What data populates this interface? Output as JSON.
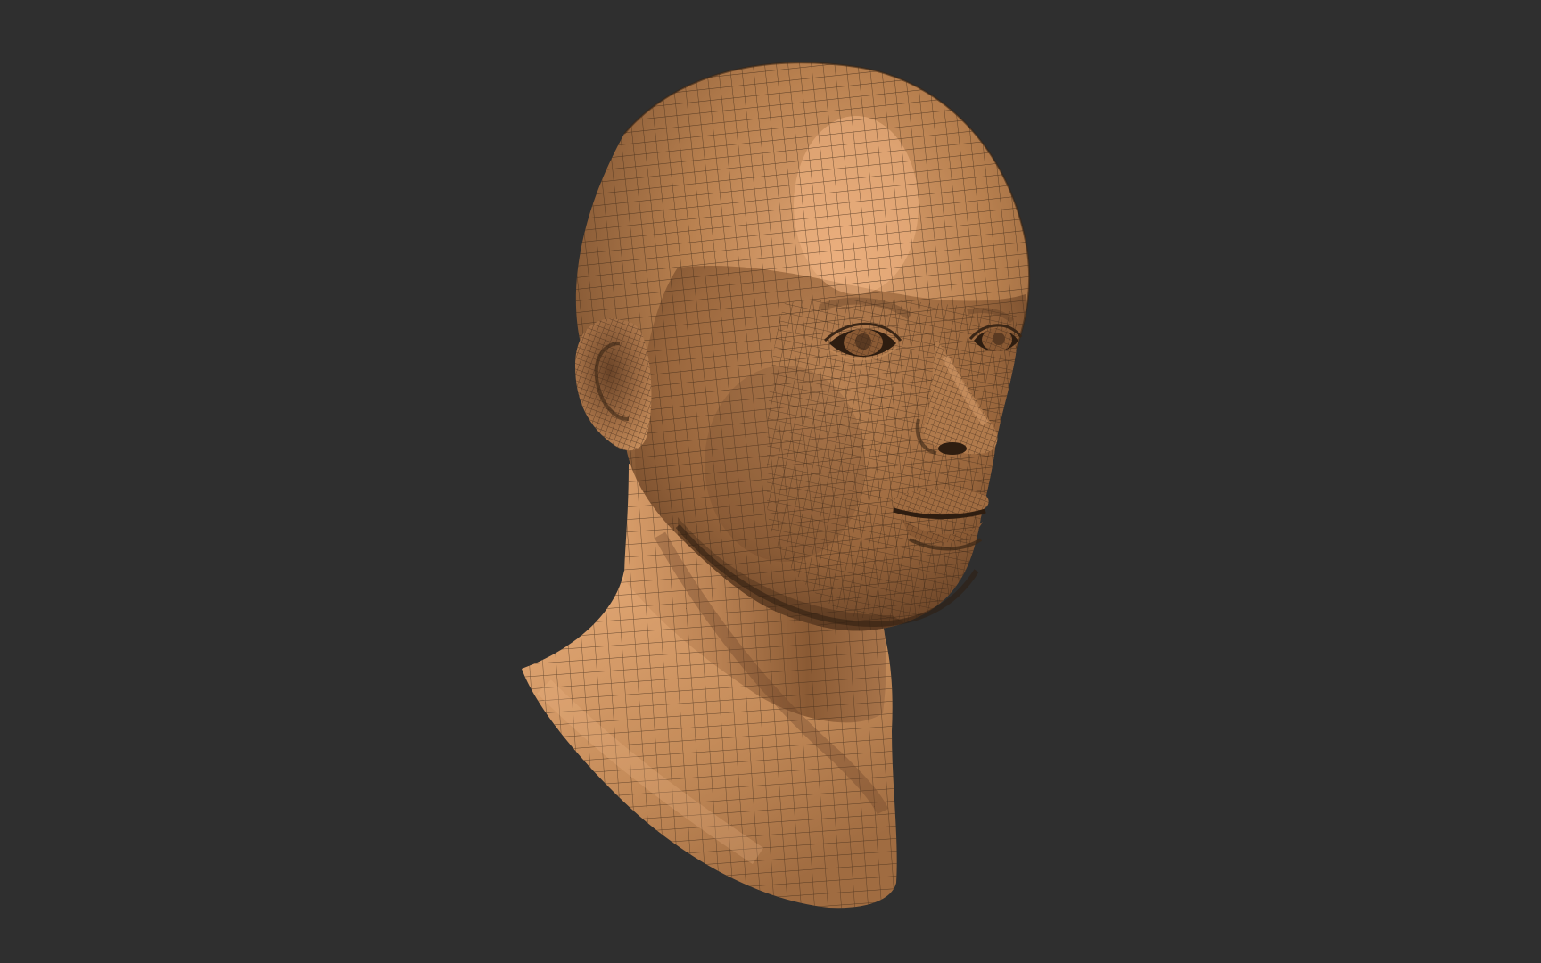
{
  "viewport": {
    "background_color": "#2f2f2f",
    "model": {
      "name": "head-bust-wireframe",
      "base_color": "#b07a4c",
      "highlight_color": "#e0a574",
      "shadow_color": "#5a3a22",
      "wire_color": "#3a2616"
    }
  }
}
